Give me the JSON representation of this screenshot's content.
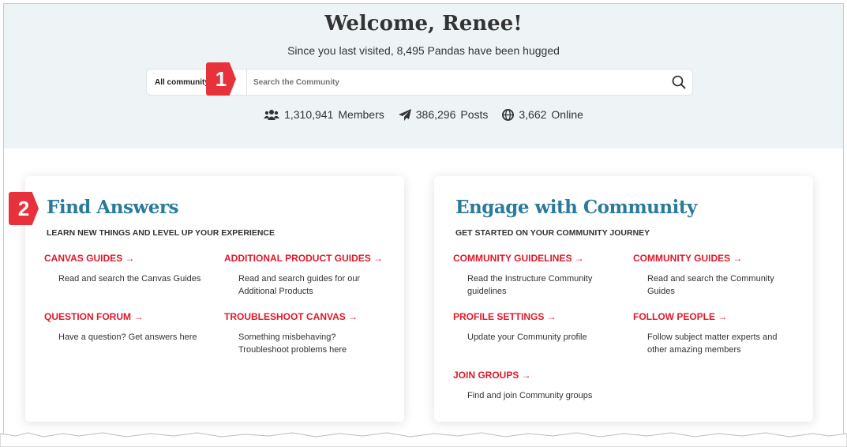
{
  "hero": {
    "title": "Welcome, Renee!",
    "subtitle": "Since you last visited, 8,495 Pandas have been hugged"
  },
  "search": {
    "scope": "All community",
    "placeholder": "Search the Community"
  },
  "stats": [
    {
      "icon": "users-icon",
      "value": "1,310,941",
      "label": "Members"
    },
    {
      "icon": "paper-plane-icon",
      "value": "386,296",
      "label": "Posts"
    },
    {
      "icon": "globe-icon",
      "value": "3,662",
      "label": "Online"
    }
  ],
  "badges": [
    "1",
    "2"
  ],
  "cards": [
    {
      "title": "Find Answers",
      "subtitle": "LEARN NEW THINGS AND LEVEL UP YOUR EXPERIENCE",
      "items": [
        {
          "label": "CANVAS GUIDES →",
          "desc": "Read and search the Canvas Guides"
        },
        {
          "label": "ADDITIONAL PRODUCT GUIDES →",
          "desc": "Read and search guides for our Additional Products"
        },
        {
          "label": "QUESTION FORUM →",
          "desc": "Have a question? Get answers here"
        },
        {
          "label": "TROUBLESHOOT CANVAS →",
          "desc": "Something misbehaving? Troubleshoot problems here"
        }
      ]
    },
    {
      "title": "Engage with Community",
      "subtitle": "GET STARTED ON YOUR COMMUNITY JOURNEY",
      "items": [
        {
          "label": "COMMUNITY GUIDELINES →",
          "desc": "Read the Instructure Community guidelines"
        },
        {
          "label": "COMMUNITY GUIDES →",
          "desc": "Read and search the Community Guides"
        },
        {
          "label": "PROFILE SETTINGS →",
          "desc": "Update your Community profile"
        },
        {
          "label": "FOLLOW PEOPLE →",
          "desc": "Follow subject matter experts and other amazing members"
        },
        {
          "label": "JOIN GROUPS →",
          "desc": "Find and join Community groups"
        }
      ]
    }
  ]
}
